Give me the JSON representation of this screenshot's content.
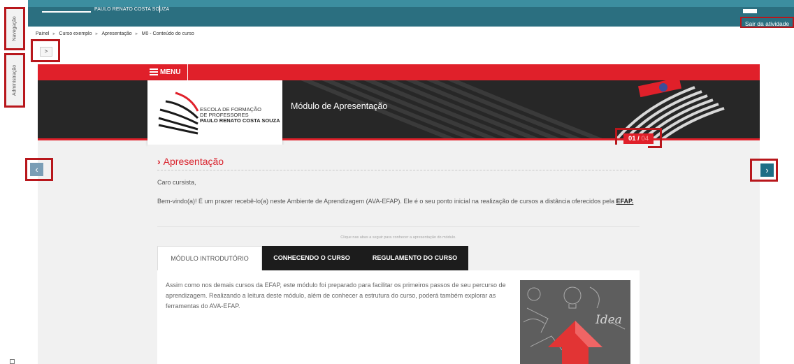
{
  "topbar": {
    "user_name": "PAULO RENATO COSTA SOUZA",
    "exit_label": "Sair da atividade"
  },
  "sidebar": {
    "navigation_label": "Navegação",
    "administration_label": "Administração"
  },
  "breadcrumb": {
    "items": [
      "Painel",
      "Curso exemplo",
      "Apresentação",
      "M0 - Conteúdo do curso"
    ]
  },
  "collapse_button": ">",
  "course": {
    "menu_label": "MENU",
    "logo_lines": [
      "ESCOLA DE FORMAÇÃO",
      "DE PROFESSORES",
      "PAULO RENATO COSTA SOUZA"
    ],
    "module_title": "Módulo de Apresentação",
    "page_current": "01",
    "page_separator": "/",
    "page_total": "04",
    "prev_symbol": "‹",
    "next_symbol": "›"
  },
  "content": {
    "section_title": "Apresentação",
    "greeting": "Caro cursista,",
    "welcome_text": "Bem-vindo(a)! É um prazer recebê-lo(a) neste Ambiente de Aprendizagem (AVA-EFAP). Ele é o seu ponto inicial na realização de cursos a distância oferecidos pela",
    "welcome_link": "EFAP.",
    "hint": "Clique nas abas a seguir para conhecer a apresentação do módulo.",
    "tabs": [
      "MÓDULO INTRODUTÓRIO",
      "CONHECENDO O CURSO",
      "REGULAMENTO DO CURSO"
    ],
    "panel_text": "Assim como nos demais cursos da EFAP, este módulo foi preparado para facilitar os primeiros passos de seu percurso de aprendizagem. Realizando a leitura deste módulo, além de conhecer a estrutura do curso, poderá também explorar as ferramentas do AVA-EFAP.",
    "panel_image_word": "Idea"
  },
  "colors": {
    "brand_red": "#e0202a",
    "teal": "#2b6f80",
    "highlight_border": "#b8171c"
  }
}
